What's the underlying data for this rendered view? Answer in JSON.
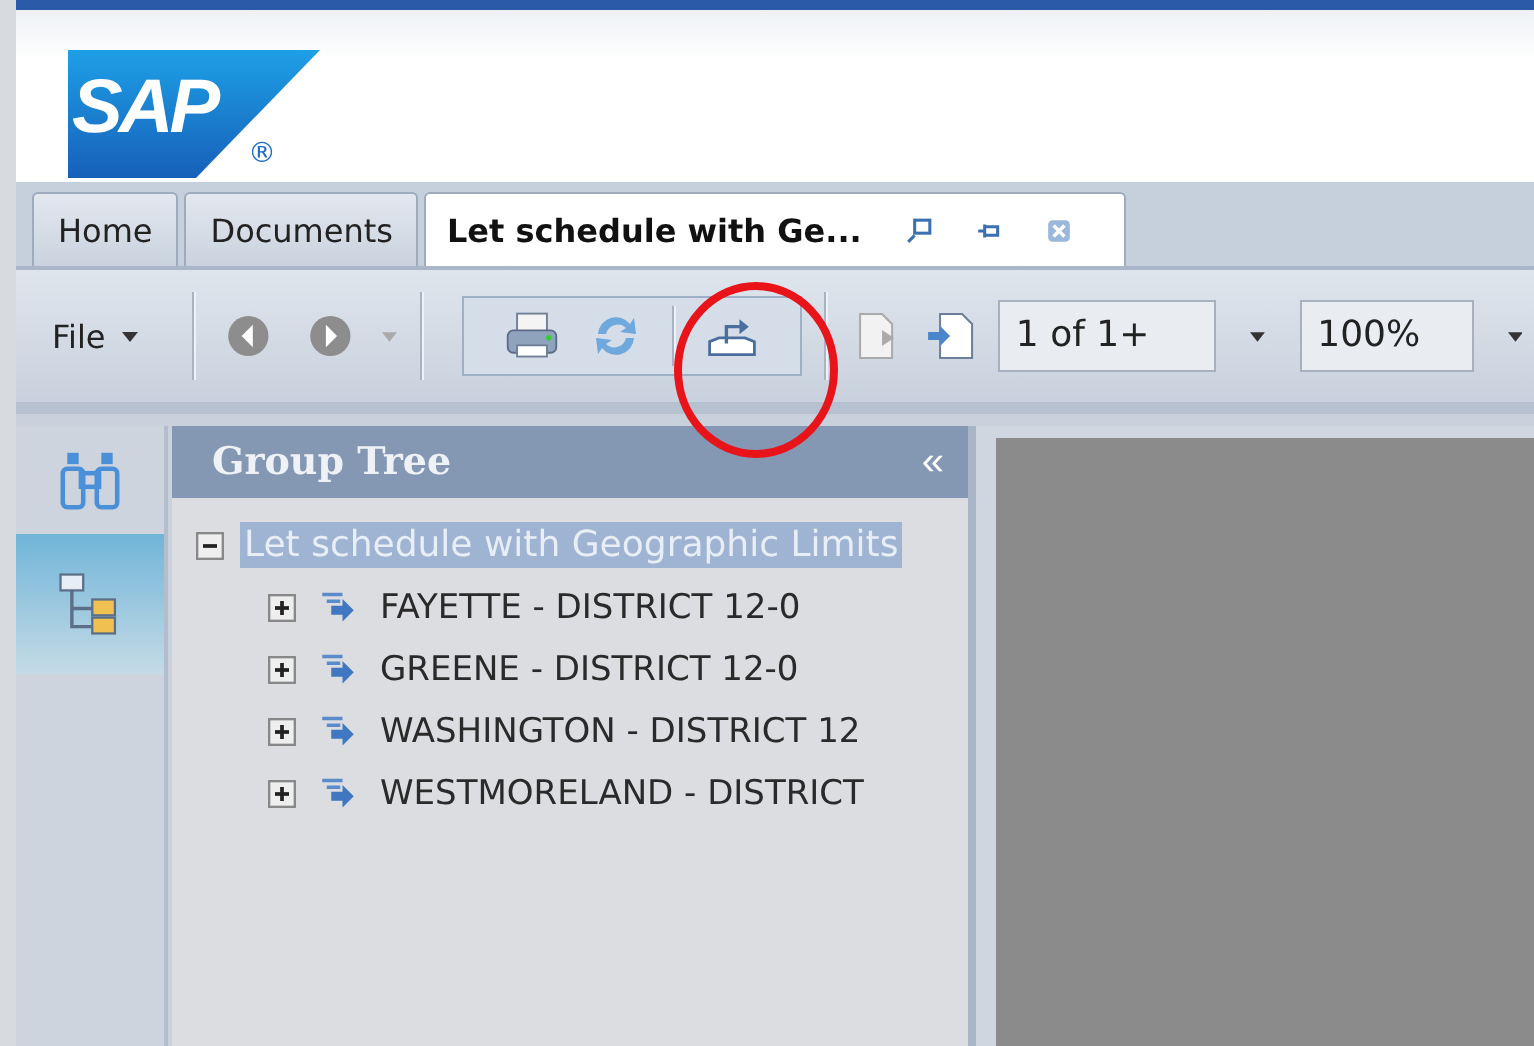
{
  "logo": {
    "text": "SAP",
    "mark": "®"
  },
  "tabs": [
    {
      "label": "Home",
      "selected": false
    },
    {
      "label": "Documents",
      "selected": false
    },
    {
      "label": "Let schedule with Ge...",
      "selected": true
    }
  ],
  "toolbar": {
    "file_menu": "File",
    "page_field": "1 of 1+",
    "zoom_field": "100%"
  },
  "side_rail": [
    {
      "kind": "search",
      "selected": false
    },
    {
      "kind": "tree",
      "selected": true
    }
  ],
  "group_tree": {
    "title": "Group Tree",
    "collapse": "«",
    "root": {
      "label": "Let schedule with Geographic Limits",
      "expanded": true,
      "selected": true,
      "children": [
        {
          "label": "FAYETTE - DISTRICT 12-0",
          "expanded": false
        },
        {
          "label": "GREENE - DISTRICT 12-0",
          "expanded": false
        },
        {
          "label": "WASHINGTON - DISTRICT 12",
          "expanded": false
        },
        {
          "label": "WESTMORELAND - DISTRICT",
          "expanded": false
        }
      ]
    }
  },
  "highlight": {
    "shown": true
  }
}
